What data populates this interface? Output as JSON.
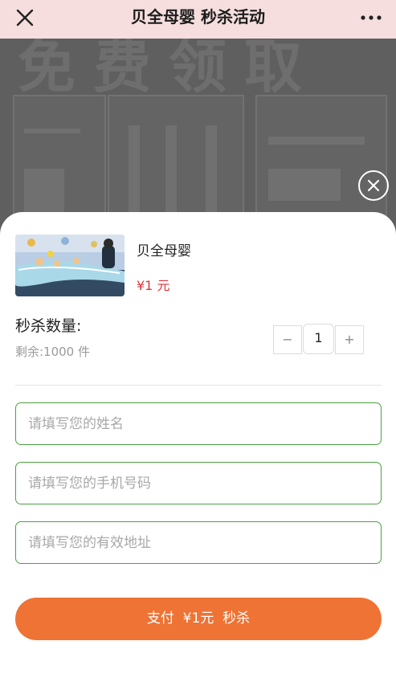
{
  "navbar": {
    "title": "贝全母婴 秒杀活动",
    "close_icon": "close-icon",
    "more_icon": "more-horizontal-icon"
  },
  "background": {
    "banner_text": "免费领取"
  },
  "modal": {
    "close_icon": "close-circle-icon"
  },
  "product": {
    "name": "贝全母婴",
    "price": "¥1 元",
    "image": "baby-swimming-pool-photo"
  },
  "quantity": {
    "label": "秒杀数量:",
    "stock": "剩余:1000 件",
    "value": "1",
    "minus_label": "−",
    "plus_label": "+"
  },
  "form": {
    "name_placeholder": "请填写您的姓名",
    "phone_placeholder": "请填写您的手机号码",
    "address_placeholder": "请填写您的有效地址"
  },
  "pay_button": {
    "label": "支付  ¥1元  秒杀"
  },
  "colors": {
    "navbar_bg": "#f6dede",
    "price_red": "#e0353a",
    "input_border": "#4aa23f",
    "pay_orange": "#ee7335",
    "overlay": "#5f5f5f"
  }
}
